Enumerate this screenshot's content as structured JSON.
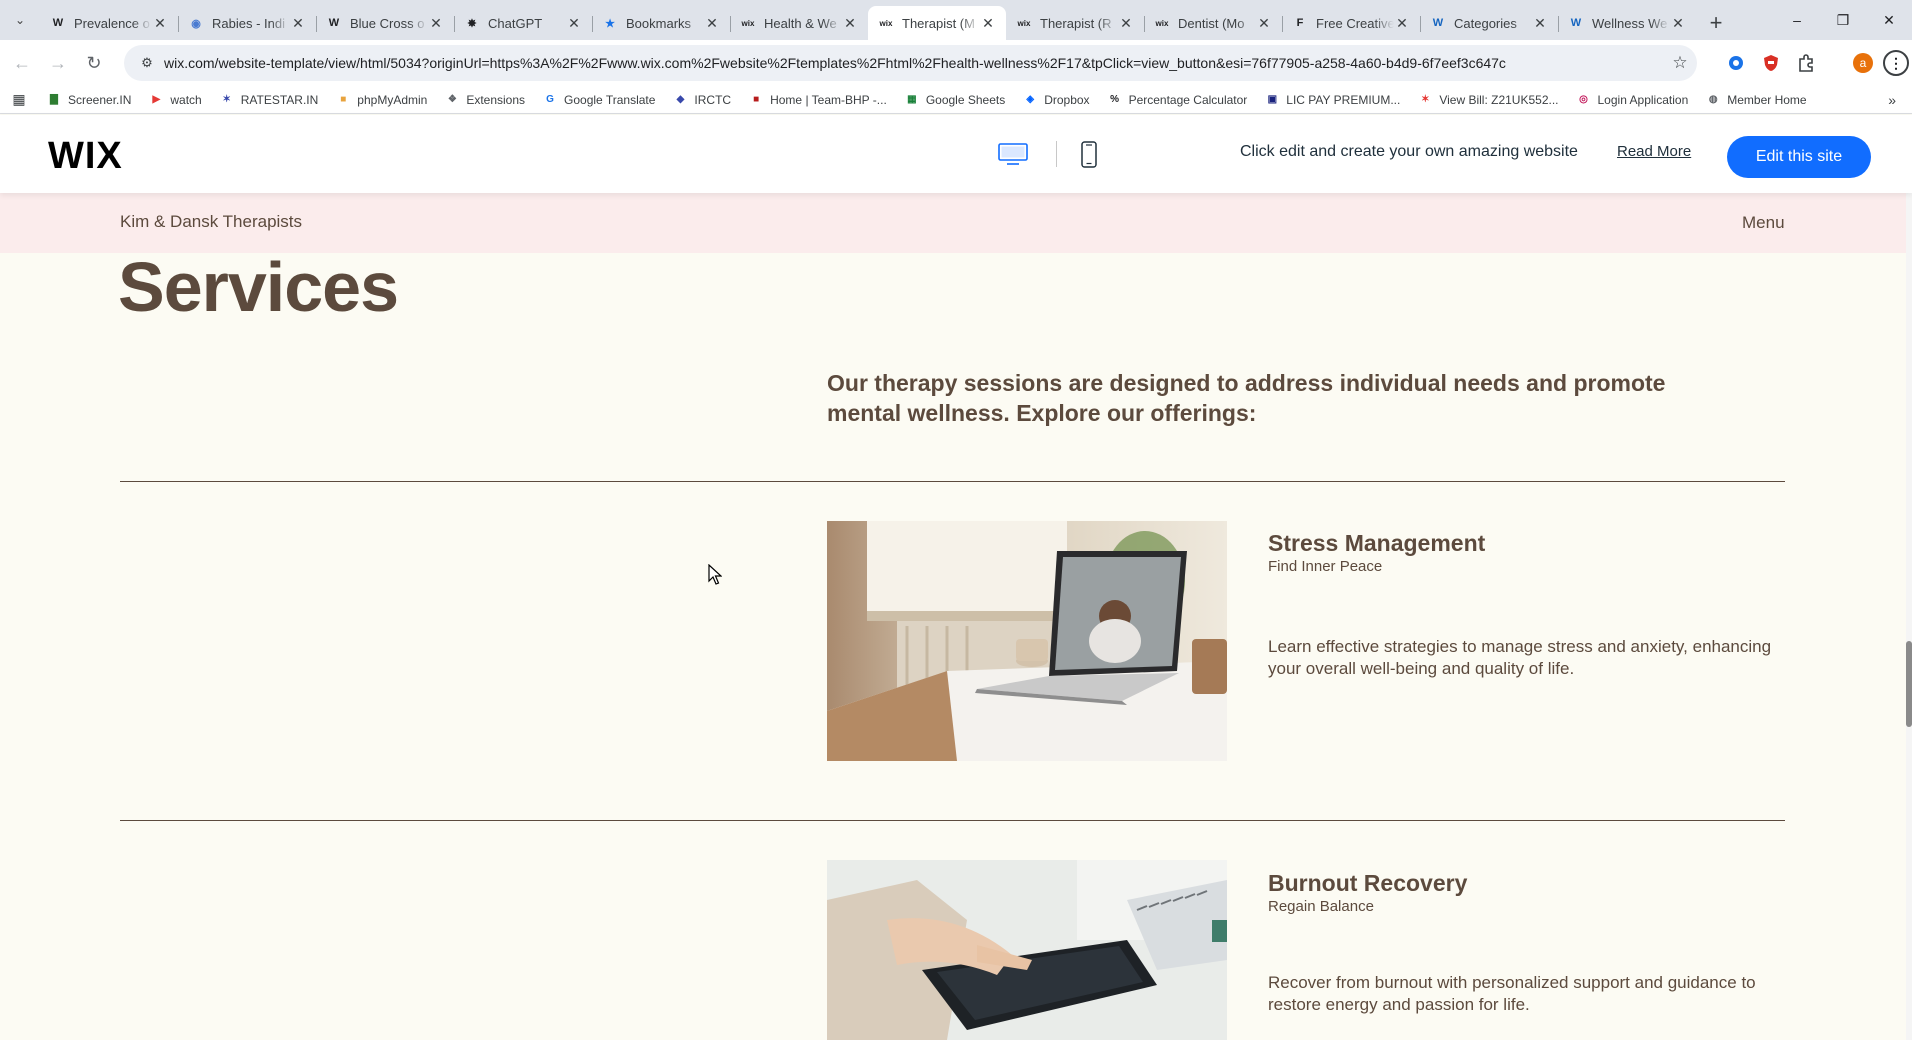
{
  "browser": {
    "tabs": [
      {
        "title": "Prevalence o",
        "favicon": "W",
        "favicon_color": "#202124"
      },
      {
        "title": "Rabies - Indi",
        "favicon": "◉",
        "favicon_color": "#4a7bd1"
      },
      {
        "title": "Blue Cross o",
        "favicon": "W",
        "favicon_color": "#202124"
      },
      {
        "title": "ChatGPT",
        "favicon": "✸",
        "favicon_color": "#202124"
      },
      {
        "title": "Bookmarks",
        "favicon": "★",
        "favicon_color": "#1a73e8"
      },
      {
        "title": "Health & We",
        "favicon": "wix",
        "favicon_color": "#202124"
      },
      {
        "title": "Therapist (M",
        "favicon": "wix",
        "favicon_color": "#202124",
        "active": true
      },
      {
        "title": "Therapist (R",
        "favicon": "wix",
        "favicon_color": "#202124"
      },
      {
        "title": "Dentist (Mo",
        "favicon": "wix",
        "favicon_color": "#202124"
      },
      {
        "title": "Free Creative",
        "favicon": "F",
        "favicon_color": "#202124"
      },
      {
        "title": "Categories",
        "favicon": "W",
        "favicon_color": "#1565c0"
      },
      {
        "title": "Wellness We",
        "favicon": "W",
        "favicon_color": "#1565c0"
      }
    ],
    "url": "wix.com/website-template/view/html/5034?originUrl=https%3A%2F%2Fwww.wix.com%2Fwebsite%2Ftemplates%2Fhtml%2Fhealth-wellness%2F17&tpClick=view_button&esi=76f77905-a258-4a60-b4d9-6f7eef3c647c",
    "profile_initial": "a",
    "bookmarks": [
      {
        "label": "Screener.IN",
        "icon": "bar-chart-icon",
        "color": "#2e7d32"
      },
      {
        "label": "watch",
        "icon": "youtube-icon",
        "color": "#e53935"
      },
      {
        "label": "RATESTAR.IN",
        "icon": "star-icon",
        "color": "#3949ab"
      },
      {
        "label": "phpMyAdmin",
        "icon": "php-icon",
        "color": "#e8a33d"
      },
      {
        "label": "Extensions",
        "icon": "puzzle-icon",
        "color": "#5f6368"
      },
      {
        "label": "Google Translate",
        "icon": "translate-icon",
        "color": "#1a73e8"
      },
      {
        "label": "IRCTC",
        "icon": "irctc-icon",
        "color": "#3949ab"
      },
      {
        "label": "Home | Team-BHP -...",
        "icon": "teambhp-icon",
        "color": "#b71c1c"
      },
      {
        "label": "Google Sheets",
        "icon": "sheets-icon",
        "color": "#188038"
      },
      {
        "label": "Dropbox",
        "icon": "dropbox-icon",
        "color": "#0061ff"
      },
      {
        "label": "Percentage Calculator",
        "icon": "percent-icon",
        "color": "#202124"
      },
      {
        "label": "LIC PAY PREMIUM...",
        "icon": "lic-icon",
        "color": "#1a237e"
      },
      {
        "label": "View Bill: Z21UK552...",
        "icon": "bill-icon",
        "color": "#e53935"
      },
      {
        "label": "Login Application",
        "icon": "login-icon",
        "color": "#c2185b"
      },
      {
        "label": "Member Home",
        "icon": "globe-icon",
        "color": "#5f6368"
      }
    ]
  },
  "wix_bar": {
    "logo": "WIX",
    "promo_text": "Click edit and create your own amazing website",
    "read_more": "Read More",
    "edit_button": "Edit this site",
    "accent": "#116dff"
  },
  "site": {
    "name": "Kim & Dansk Therapists",
    "menu": "Menu",
    "heading": "Services",
    "intro": "Our therapy sessions are designed to address individual needs and promote mental wellness. Explore our offerings:",
    "services": [
      {
        "title": "Stress Management",
        "subtitle": "Find Inner Peace",
        "description": "Learn effective strategies to manage stress and anxiety, enhancing your overall well-being and quality of life."
      },
      {
        "title": "Burnout Recovery",
        "subtitle": "Regain Balance",
        "description": "Recover from burnout with personalized support and guidance to restore energy and passion for life."
      }
    ],
    "colors": {
      "text_brown": "#5c4a3d",
      "page_bg": "#fcfbf3",
      "header_bg": "#fbecec"
    }
  }
}
